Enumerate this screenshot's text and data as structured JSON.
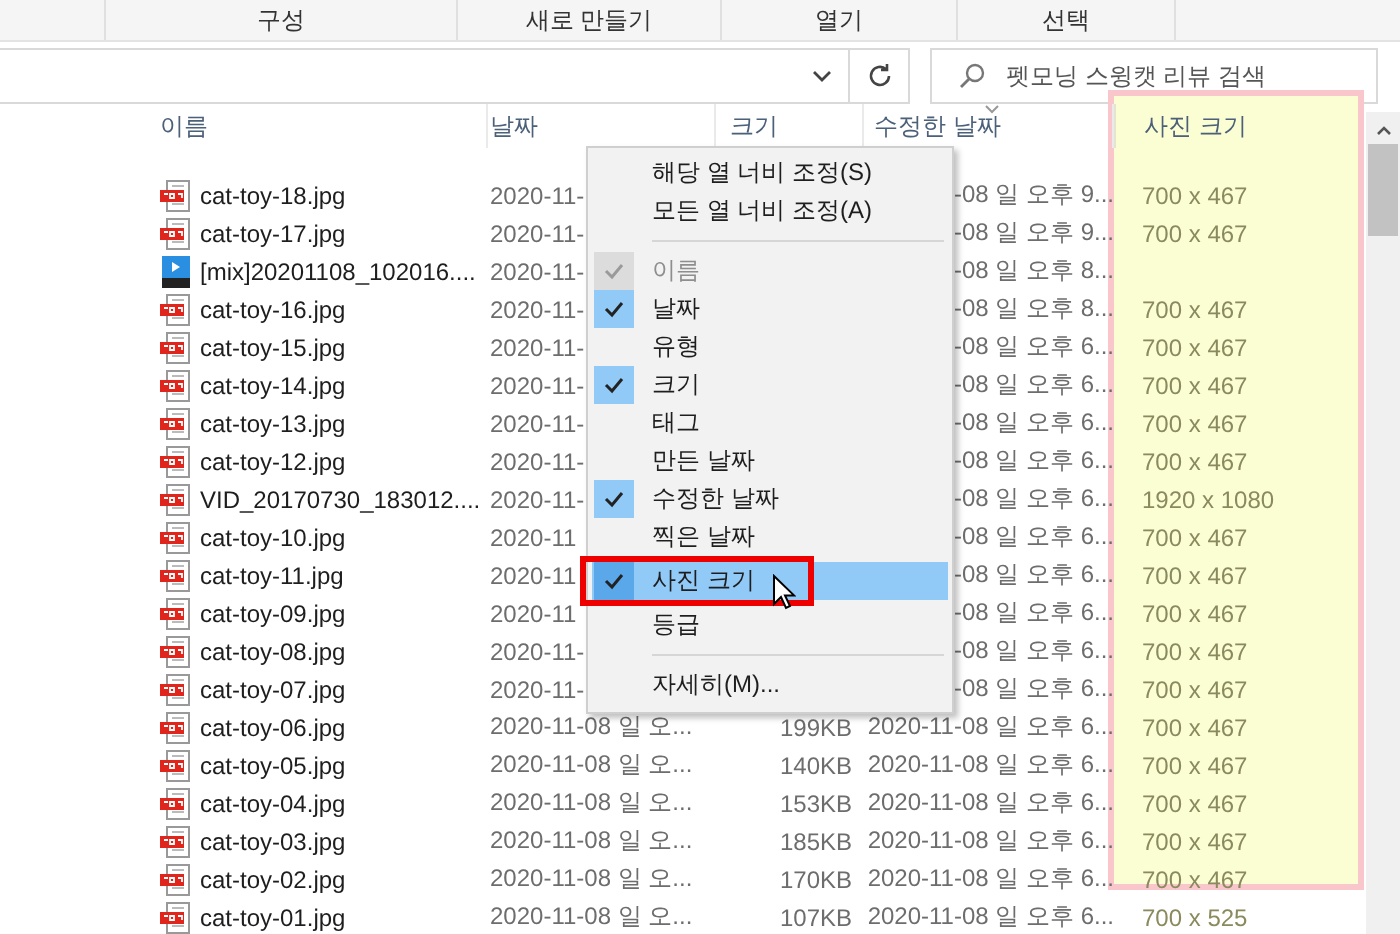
{
  "toolbar": [
    {
      "label": "구성"
    },
    {
      "label": "새로 만들기"
    },
    {
      "label": "열기"
    },
    {
      "label": "선택"
    }
  ],
  "search": {
    "placeholder": "펫모닝 스윙캣 리뷰 검색"
  },
  "columns": [
    {
      "label": "이름",
      "sorted": false
    },
    {
      "label": "날짜",
      "sorted": false
    },
    {
      "label": "크기",
      "sorted": false
    },
    {
      "label": "수정한 날짜",
      "sorted": true
    },
    {
      "label": "사진 크기",
      "sorted": false
    }
  ],
  "files": [
    {
      "kind": "jpg",
      "name": "cat-toy-18.jpg",
      "date": "2020-11-",
      "modified": "-08 일 오후 9...",
      "photo_size": "700 x 467"
    },
    {
      "kind": "jpg",
      "name": "cat-toy-17.jpg",
      "date": "2020-11-",
      "modified": "-08 일 오후 9...",
      "photo_size": "700 x 467"
    },
    {
      "kind": "video",
      "name": "[mix]20201108_102016....",
      "date": "2020-11-",
      "modified": "-08 일 오후 8..."
    },
    {
      "kind": "jpg",
      "name": "cat-toy-16.jpg",
      "date": "2020-11-",
      "modified": "-08 일 오후 8...",
      "photo_size": "700 x 467"
    },
    {
      "kind": "jpg",
      "name": "cat-toy-15.jpg",
      "date": "2020-11-",
      "modified": "-08 일 오후 6...",
      "photo_size": "700 x 467"
    },
    {
      "kind": "jpg",
      "name": "cat-toy-14.jpg",
      "date": "2020-11-",
      "modified": "-08 일 오후 6...",
      "photo_size": "700 x 467"
    },
    {
      "kind": "jpg",
      "name": "cat-toy-13.jpg",
      "date": "2020-11-",
      "modified": "-08 일 오후 6...",
      "photo_size": "700 x 467"
    },
    {
      "kind": "jpg",
      "name": "cat-toy-12.jpg",
      "date": "2020-11-",
      "modified": "-08 일 오후 6...",
      "photo_size": "700 x 467"
    },
    {
      "kind": "jpg",
      "name": "VID_20170730_183012....",
      "date": "2020-11-",
      "modified": "-08 일 오후 6...",
      "photo_size": "1920 x 1080"
    },
    {
      "kind": "jpg",
      "name": "cat-toy-10.jpg",
      "date": "2020-11",
      "modified": "-08 일 오후 6...",
      "photo_size": "700 x 467"
    },
    {
      "kind": "jpg",
      "name": "cat-toy-11.jpg",
      "date": "2020-11",
      "modified": "-08 일 오후 6...",
      "photo_size": "700 x 467"
    },
    {
      "kind": "jpg",
      "name": "cat-toy-09.jpg",
      "date": "2020-11",
      "modified": "-08 일 오후 6...",
      "photo_size": "700 x 467"
    },
    {
      "kind": "jpg",
      "name": "cat-toy-08.jpg",
      "date": "2020-11-",
      "modified": "-08 일 오후 6...",
      "photo_size": "700 x 467"
    },
    {
      "kind": "jpg",
      "name": "cat-toy-07.jpg",
      "date": "2020-11-",
      "modified": "-08 일 오후 6...",
      "photo_size": "700 x 467"
    },
    {
      "kind": "jpg",
      "name": "cat-toy-06.jpg",
      "date": "2020-11-08 일 오...",
      "size": "199KB",
      "modified": "2020-11-08 일 오후 6...",
      "photo_size": "700 x 467"
    },
    {
      "kind": "jpg",
      "name": "cat-toy-05.jpg",
      "date": "2020-11-08 일 오...",
      "size": "140KB",
      "modified": "2020-11-08 일 오후 6...",
      "photo_size": "700 x 467"
    },
    {
      "kind": "jpg",
      "name": "cat-toy-04.jpg",
      "date": "2020-11-08 일 오...",
      "size": "153KB",
      "modified": "2020-11-08 일 오후 6...",
      "photo_size": "700 x 467"
    },
    {
      "kind": "jpg",
      "name": "cat-toy-03.jpg",
      "date": "2020-11-08 일 오...",
      "size": "185KB",
      "modified": "2020-11-08 일 오후 6...",
      "photo_size": "700 x 467"
    },
    {
      "kind": "jpg",
      "name": "cat-toy-02.jpg",
      "date": "2020-11-08 일 오...",
      "size": "170KB",
      "modified": "2020-11-08 일 오후 6...",
      "photo_size": "700 x 467"
    },
    {
      "kind": "jpg",
      "name": "cat-toy-01.jpg",
      "date": "2020-11-08 일 오...",
      "size": "107KB",
      "modified": "2020-11-08 일 오후 6...",
      "photo_size": "700 x 525"
    }
  ],
  "column_menu": {
    "items": [
      {
        "kind": "command",
        "label": "해당 열 너비 조정(S)",
        "selected": false
      },
      {
        "kind": "command",
        "label": "모든 열 너비 조정(A)",
        "selected": false
      },
      {
        "kind": "separator"
      },
      {
        "kind": "column",
        "label": "이름",
        "checked": true,
        "disabled": true,
        "selected": false
      },
      {
        "kind": "column",
        "label": "날짜",
        "checked": true,
        "disabled": false,
        "selected": false
      },
      {
        "kind": "column",
        "label": "유형",
        "checked": false,
        "disabled": false,
        "selected": false
      },
      {
        "kind": "column",
        "label": "크기",
        "checked": true,
        "disabled": false,
        "selected": false
      },
      {
        "kind": "column",
        "label": "태그",
        "checked": false,
        "disabled": false,
        "selected": false
      },
      {
        "kind": "column",
        "label": "만든 날짜",
        "checked": false,
        "disabled": false,
        "selected": false
      },
      {
        "kind": "column",
        "label": "수정한 날짜",
        "checked": true,
        "disabled": false,
        "selected": false
      },
      {
        "kind": "column",
        "label": "찍은 날짜",
        "checked": false,
        "disabled": false,
        "selected": false
      },
      {
        "kind": "column",
        "label": "사진 크기",
        "checked": true,
        "disabled": false,
        "selected": true
      },
      {
        "kind": "column",
        "label": "등급",
        "checked": false,
        "disabled": false,
        "selected": false
      },
      {
        "kind": "separator"
      },
      {
        "kind": "command",
        "label": "자세히(M)...",
        "selected": false
      }
    ]
  }
}
